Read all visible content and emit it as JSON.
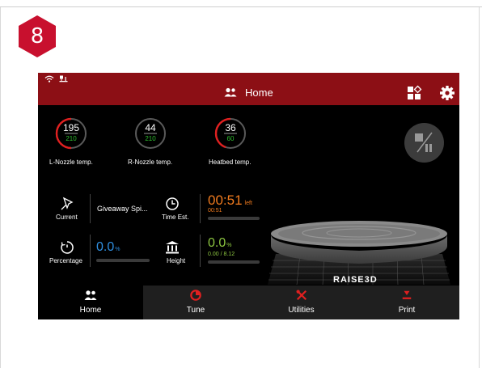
{
  "step": {
    "number": "8",
    "color": "#c8102e"
  },
  "screen": {
    "header": {
      "title": "Home",
      "title_icon": "users-icon",
      "status_icons": [
        "wifi-icon",
        "usb-icon"
      ],
      "buttons": [
        "grid-view-icon",
        "settings-gear-icon"
      ],
      "bg_color": "#8c0f15"
    },
    "temps": [
      {
        "current": "195",
        "target": "210",
        "label": "L-Nozzle temp.",
        "active": true
      },
      {
        "current": "44",
        "target": "210",
        "label": "R-Nozzle temp.",
        "active": false
      },
      {
        "current": "36",
        "target": "60",
        "label": "Heatbed temp.",
        "active": true
      }
    ],
    "current": {
      "label": "Current",
      "value": "Giveaway Spi..."
    },
    "time": {
      "label": "Time Est.",
      "value": "00:51",
      "unit": "left",
      "elapsed": "00:51"
    },
    "percentage": {
      "label": "Percentage",
      "value": "0.0",
      "unit": "%",
      "progress": 0.0
    },
    "height": {
      "label": "Height",
      "value": "0.0",
      "unit": "%",
      "detail": "0.00 / 8.12",
      "progress": 0.0
    },
    "brand": "RAISE3D",
    "nav": [
      {
        "label": "Home",
        "icon": "users-icon",
        "active": true
      },
      {
        "label": "Tune",
        "icon": "tune-dial-icon",
        "active": false
      },
      {
        "label": "Utilities",
        "icon": "tools-icon",
        "active": false
      },
      {
        "label": "Print",
        "icon": "print-icon",
        "active": false
      }
    ],
    "colors": {
      "accent_red": "#e02020",
      "orange": "#f07a1e",
      "blue": "#2f8fe0",
      "green": "#8cc540"
    }
  }
}
